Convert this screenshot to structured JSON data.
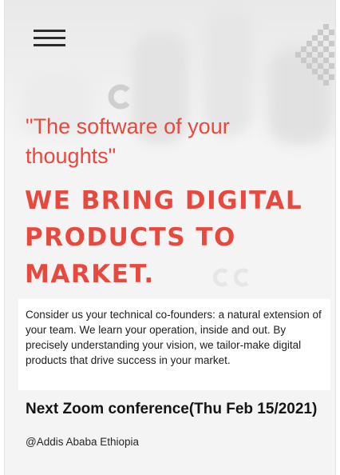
{
  "header": {
    "menu_icon": "hamburger-menu-icon"
  },
  "hero": {
    "tagline": "\"The software of your thoughts\"",
    "headline": "We bring digital products to market.",
    "accent_color": "#e8493f"
  },
  "intro": {
    "text": "Consider us your technical co-founders: a natural extension of your team. We learn your operation, inside and out. By precisely understanding your vision, we tailor-make digital products that drive success in your market."
  },
  "event": {
    "title": "Next Zoom conference(Thu Feb 15/2021)",
    "location": "@Addis Ababa Ethiopia"
  }
}
